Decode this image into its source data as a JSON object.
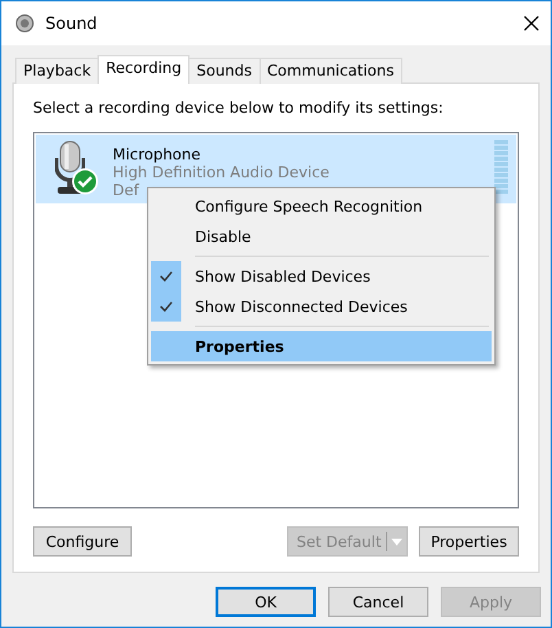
{
  "window": {
    "title": "Sound"
  },
  "tabs": [
    {
      "label": "Playback",
      "selected": false
    },
    {
      "label": "Recording",
      "selected": true
    },
    {
      "label": "Sounds",
      "selected": false
    },
    {
      "label": "Communications",
      "selected": false
    }
  ],
  "instruction": "Select a recording device below to modify its settings:",
  "devices": [
    {
      "name": "Microphone",
      "description": "High Definition Audio Device",
      "status": "Def",
      "selected": true,
      "is_default": true
    }
  ],
  "context_menu": [
    {
      "kind": "item",
      "label": "Configure Speech Recognition",
      "checked": false,
      "selected": false,
      "default": false
    },
    {
      "kind": "item",
      "label": "Disable",
      "checked": false,
      "selected": false,
      "default": false
    },
    {
      "kind": "separator"
    },
    {
      "kind": "item",
      "label": "Show Disabled Devices",
      "checked": true,
      "selected": false,
      "default": false
    },
    {
      "kind": "item",
      "label": "Show Disconnected Devices",
      "checked": true,
      "selected": false,
      "default": false
    },
    {
      "kind": "separator"
    },
    {
      "kind": "item",
      "label": "Properties",
      "checked": false,
      "selected": true,
      "default": true
    }
  ],
  "panel_buttons": {
    "configure": {
      "label": "Configure",
      "disabled": false
    },
    "set_default": {
      "label": "Set Default",
      "disabled": true
    },
    "properties": {
      "label": "Properties",
      "disabled": false
    }
  },
  "dialog_buttons": [
    {
      "label": "OK",
      "disabled": false,
      "focused": true
    },
    {
      "label": "Cancel",
      "disabled": false,
      "focused": false
    },
    {
      "label": "Apply",
      "disabled": true,
      "focused": false
    }
  ]
}
